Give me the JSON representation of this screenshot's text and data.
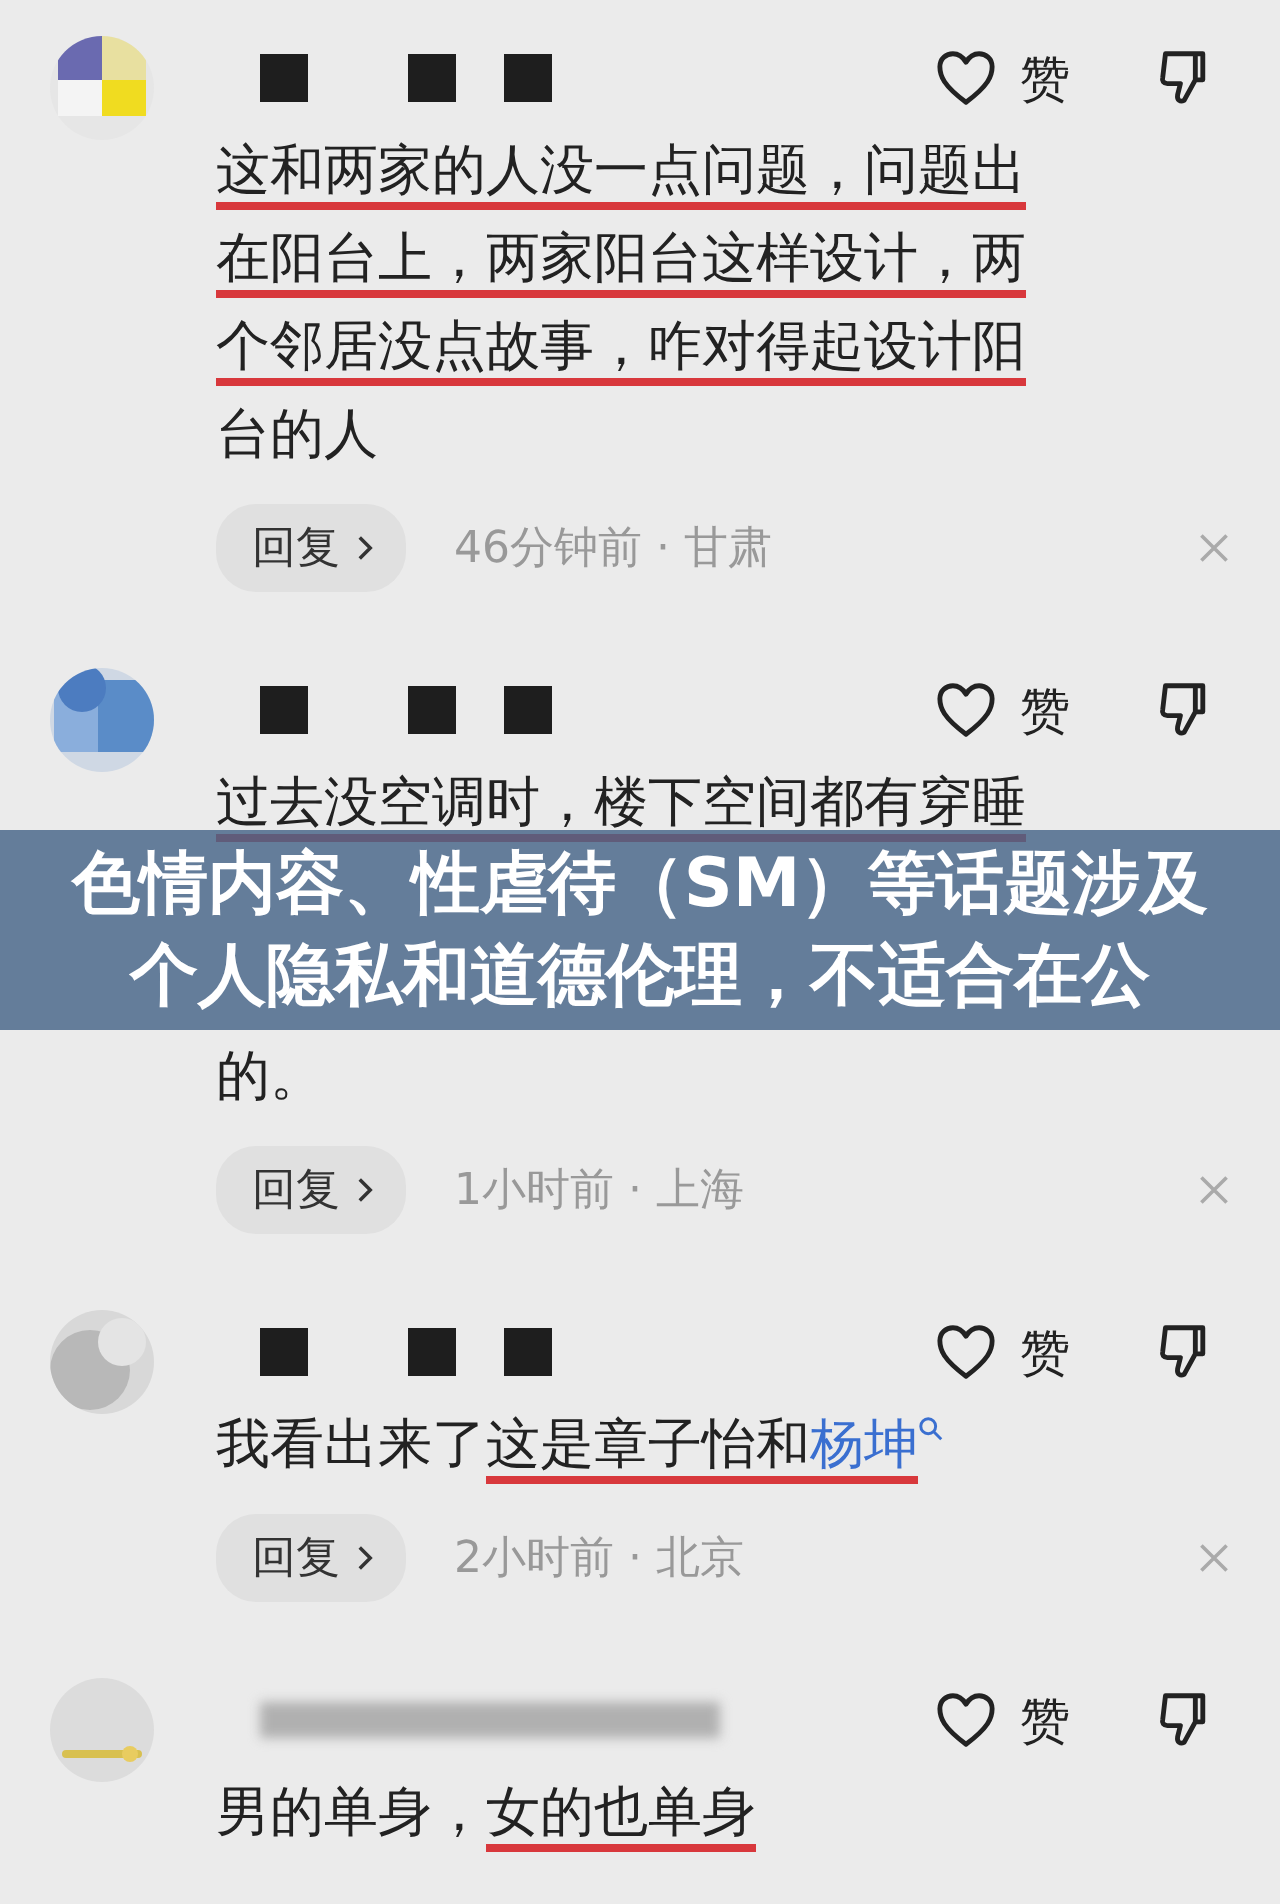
{
  "caption_banner": {
    "text": "色情内容、性虐待（SM）等话题涉及个人隐私和道德伦理，不适合在公"
  },
  "comments": [
    {
      "like_label": "赞",
      "lines": [
        {
          "kind": "text",
          "segments": [
            {
              "text": "这和两家的人没一点问题，问题出",
              "underlined": true,
              "link": false
            }
          ]
        },
        {
          "kind": "text",
          "segments": [
            {
              "text": "在阳台上，两家阳台这样设计，两",
              "underlined": true,
              "link": false
            }
          ]
        },
        {
          "kind": "text",
          "segments": [
            {
              "text": "个邻居没点故事，咋对得起设计阳",
              "underlined": true,
              "link": false
            }
          ]
        },
        {
          "kind": "text",
          "segments": [
            {
              "text": "台的人",
              "underlined": false,
              "link": false
            }
          ]
        }
      ],
      "reply_label": "回复",
      "meta": "46分钟前 · 甘肃"
    },
    {
      "like_label": "赞",
      "lines": [
        {
          "kind": "text",
          "segments": [
            {
              "text": "过去没空调时，楼下空间都有穿睡",
              "underlined": true,
              "link": false
            }
          ]
        },
        {
          "kind": "banner"
        },
        {
          "kind": "text",
          "segments": [
            {
              "text": "的。",
              "underlined": false,
              "link": false
            }
          ]
        }
      ],
      "reply_label": "回复",
      "meta": "1小时前 · 上海"
    },
    {
      "like_label": "赞",
      "lines": [
        {
          "kind": "text",
          "segments": [
            {
              "text": "我看出来了 ",
              "underlined": false,
              "link": false
            },
            {
              "text": "这是章子怡和",
              "underlined": true,
              "link": false
            },
            {
              "text": "杨坤",
              "underlined": true,
              "link": true
            }
          ]
        }
      ],
      "reply_label": "回复",
      "meta": "2小时前 · 北京"
    },
    {
      "like_label": "赞",
      "lines": [
        {
          "kind": "text",
          "segments": [
            {
              "text": "男的单身，",
              "underlined": false,
              "link": false
            },
            {
              "text": "女的也单身",
              "underlined": true,
              "link": false
            }
          ]
        }
      ]
    }
  ]
}
